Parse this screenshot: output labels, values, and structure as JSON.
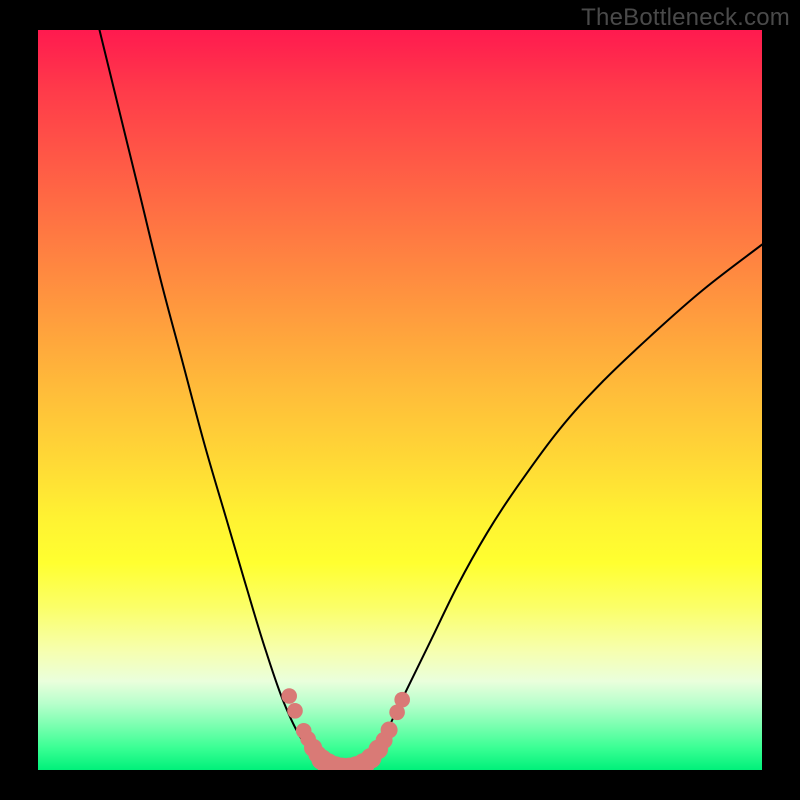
{
  "watermark": "TheBottleneck.com",
  "colors": {
    "line": "#000000",
    "markers": "#d97a76",
    "frame": "#000000"
  },
  "chart_data": {
    "type": "line",
    "title": "",
    "xlabel": "",
    "ylabel": "",
    "xlim": [
      0,
      100
    ],
    "ylim": [
      0,
      100
    ],
    "grid": false,
    "curve_points": [
      {
        "x": 8.5,
        "y": 100
      },
      {
        "x": 11,
        "y": 90
      },
      {
        "x": 14,
        "y": 78
      },
      {
        "x": 17,
        "y": 66
      },
      {
        "x": 20,
        "y": 55
      },
      {
        "x": 23,
        "y": 44
      },
      {
        "x": 26,
        "y": 34
      },
      {
        "x": 29,
        "y": 24
      },
      {
        "x": 31.5,
        "y": 16
      },
      {
        "x": 34,
        "y": 9
      },
      {
        "x": 36.5,
        "y": 4
      },
      {
        "x": 39,
        "y": 1
      },
      {
        "x": 41,
        "y": 0
      },
      {
        "x": 43,
        "y": 0
      },
      {
        "x": 45,
        "y": 1
      },
      {
        "x": 47.5,
        "y": 4
      },
      {
        "x": 50,
        "y": 9
      },
      {
        "x": 54,
        "y": 17
      },
      {
        "x": 58,
        "y": 25
      },
      {
        "x": 62,
        "y": 32
      },
      {
        "x": 66,
        "y": 38
      },
      {
        "x": 72,
        "y": 46
      },
      {
        "x": 78,
        "y": 52.5
      },
      {
        "x": 85,
        "y": 59
      },
      {
        "x": 92,
        "y": 65
      },
      {
        "x": 100,
        "y": 71
      }
    ],
    "markers": [
      {
        "x": 34.7,
        "y": 10,
        "r": 1.2
      },
      {
        "x": 35.5,
        "y": 8,
        "r": 1.2
      },
      {
        "x": 36.7,
        "y": 5.3,
        "r": 1.2
      },
      {
        "x": 37.3,
        "y": 4.2,
        "r": 1.2
      },
      {
        "x": 38.0,
        "y": 3.0,
        "r": 1.4
      },
      {
        "x": 38.6,
        "y": 2.1,
        "r": 1.4
      },
      {
        "x": 39.2,
        "y": 1.4,
        "r": 1.6
      },
      {
        "x": 40.0,
        "y": 0.8,
        "r": 1.7
      },
      {
        "x": 41.0,
        "y": 0.3,
        "r": 1.8
      },
      {
        "x": 42.0,
        "y": 0.1,
        "r": 1.8
      },
      {
        "x": 43.0,
        "y": 0.1,
        "r": 1.8
      },
      {
        "x": 44.0,
        "y": 0.3,
        "r": 1.8
      },
      {
        "x": 45.0,
        "y": 0.8,
        "r": 1.7
      },
      {
        "x": 46.0,
        "y": 1.6,
        "r": 1.6
      },
      {
        "x": 47.0,
        "y": 2.8,
        "r": 1.5
      },
      {
        "x": 47.8,
        "y": 4.0,
        "r": 1.3
      },
      {
        "x": 48.5,
        "y": 5.4,
        "r": 1.3
      },
      {
        "x": 49.6,
        "y": 7.8,
        "r": 1.2
      },
      {
        "x": 50.3,
        "y": 9.5,
        "r": 1.2
      }
    ]
  }
}
